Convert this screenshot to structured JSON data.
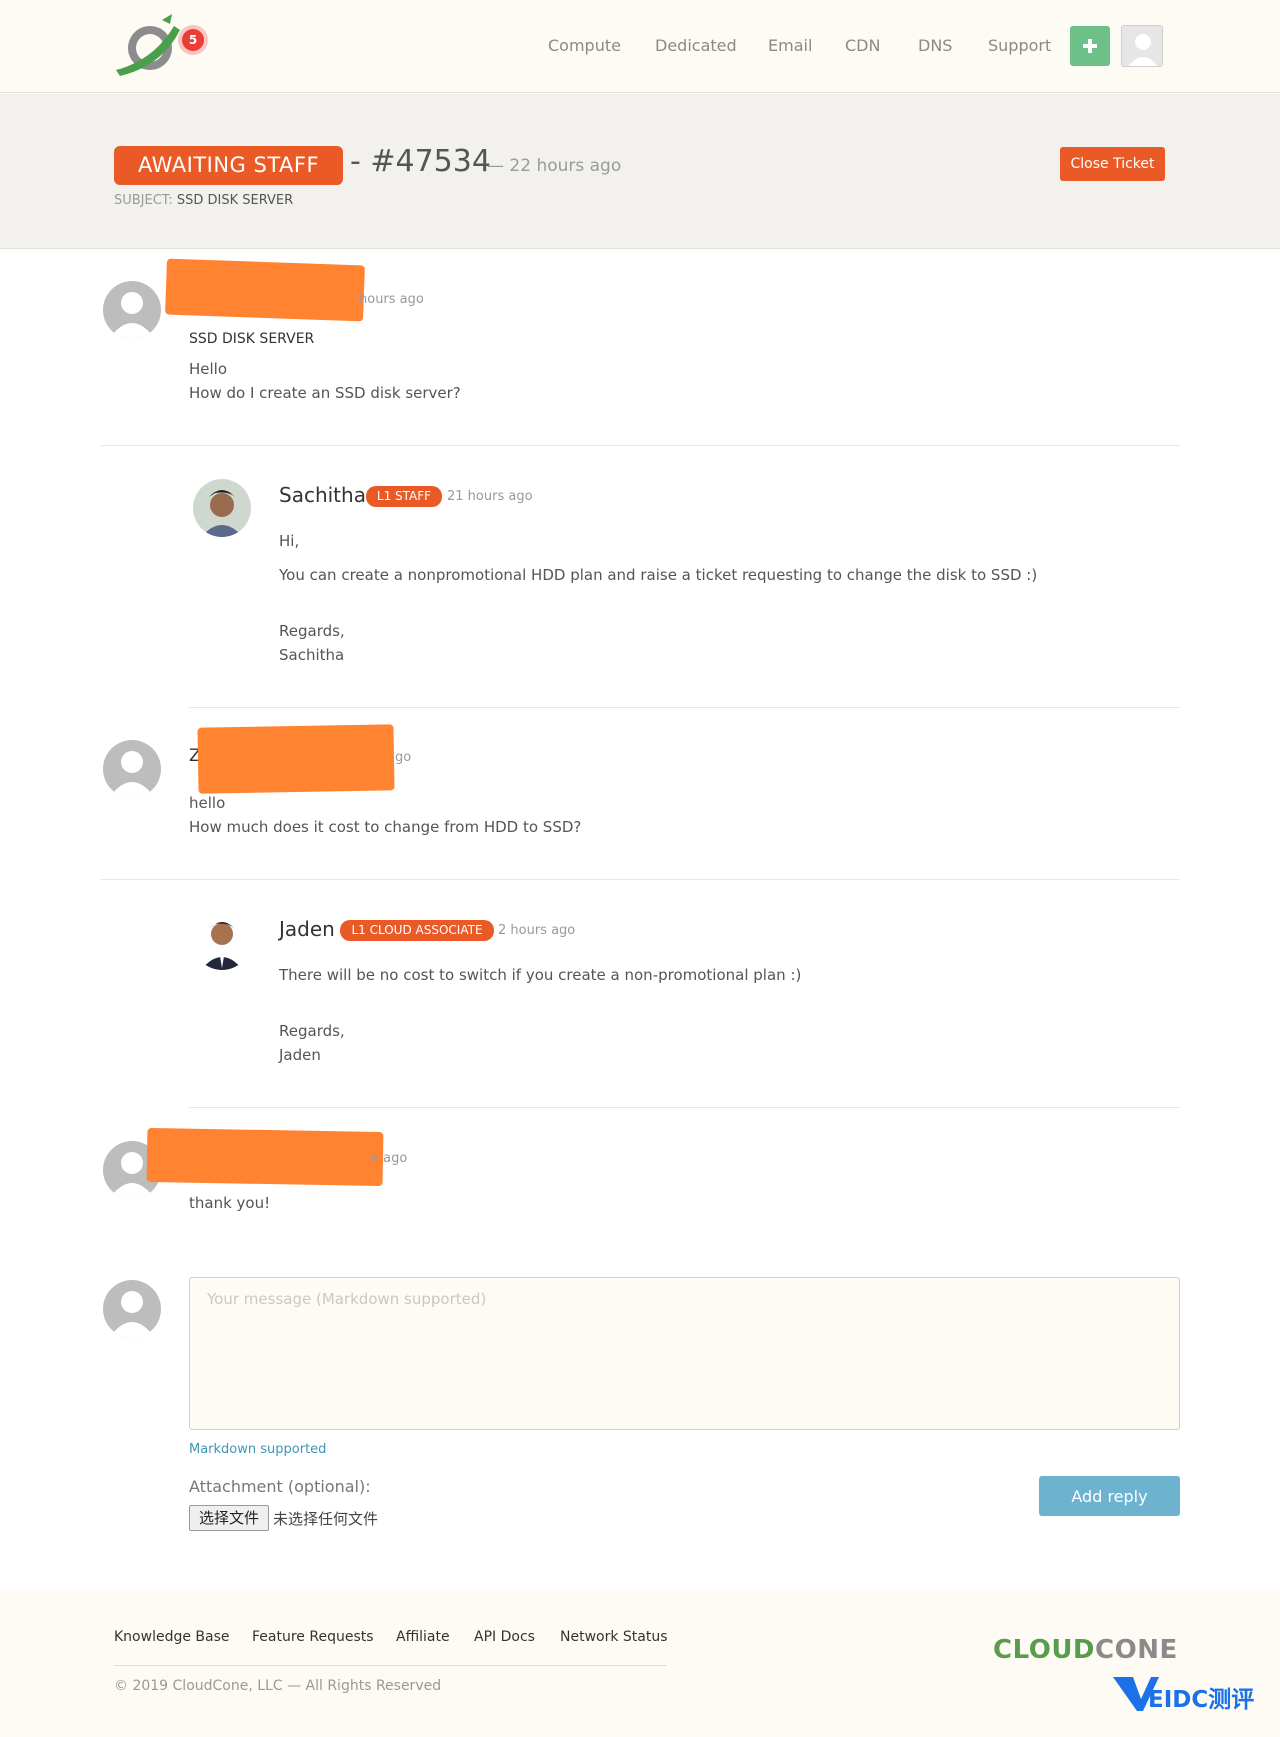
{
  "header": {
    "notification_count": "5",
    "nav": [
      "Compute",
      "Dedicated",
      "Email",
      "CDN",
      "DNS",
      "Support"
    ]
  },
  "ticket": {
    "status": "AWAITING STAFF",
    "number": "- #47534",
    "age": "— 22 hours ago",
    "subject_label": "SUBJECT:",
    "subject": "SSD DISK SERVER",
    "close_label": "Close Ticket"
  },
  "messages": [
    {
      "time": "hours ago",
      "title": "SSD DISK SERVER",
      "lines": [
        "Hello",
        "How do I create an SSD disk server?"
      ]
    },
    {
      "author": "Sachitha",
      "badge": "L1 STAFF",
      "time": "21 hours ago",
      "lines": [
        "Hi,",
        "You can create a nonpromotional HDD plan and raise a ticket requesting to change the disk to SSD :)",
        "Regards,",
        "Sachitha"
      ]
    },
    {
      "author_partial": "Z",
      "time": "go",
      "lines": [
        "hello",
        "How much does it cost to change from HDD to SSD?"
      ]
    },
    {
      "author": "Jaden",
      "badge": "L1 CLOUD ASSOCIATE",
      "time": "2 hours ago",
      "lines": [
        "There will be no cost to switch if you create a non-promotional plan :)",
        "Regards,",
        "Jaden"
      ]
    },
    {
      "time": "e ago",
      "lines": [
        "thank you!"
      ]
    }
  ],
  "reply": {
    "placeholder": "Your message (Markdown supported)",
    "markdown_link": "Markdown supported",
    "attachment_label": "Attachment (optional):",
    "file_button": "选择文件",
    "file_none": "未选择任何文件",
    "submit": "Add reply"
  },
  "footer": {
    "links": [
      "Knowledge Base",
      "Feature Requests",
      "Affiliate",
      "API Docs",
      "Network Status"
    ],
    "copyright": "© 2019 CloudCone, LLC — All Rights Reserved",
    "brand_a": "CLOUD",
    "brand_b": "CONE",
    "watermark": "EIDC测评"
  },
  "colors": {
    "accent": "#ea5a26",
    "plus_button": "#6dc088",
    "reply_button": "#6db3cf",
    "redaction": "#ff8330",
    "brand_green": "#5a9b4e"
  }
}
